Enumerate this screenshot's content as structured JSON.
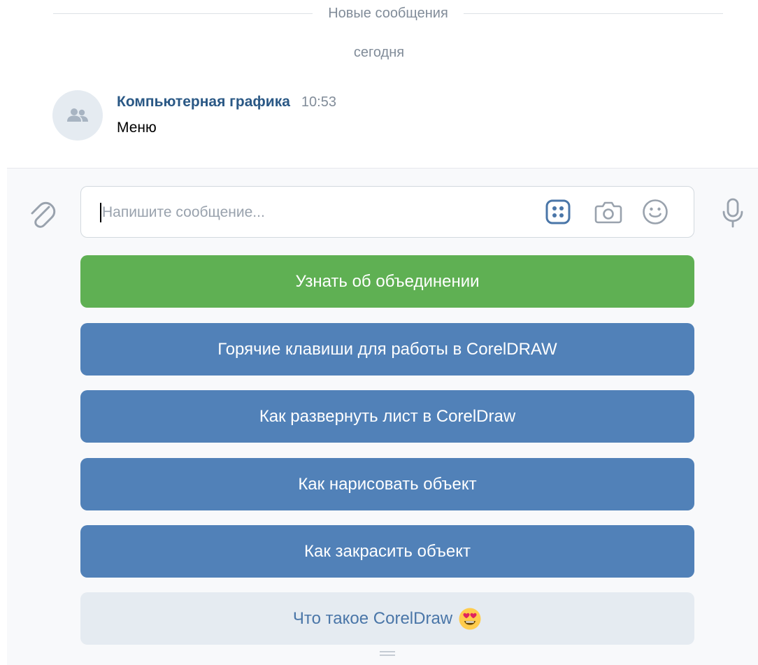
{
  "divider": {
    "label": "Новые сообщения"
  },
  "date_label": "сегодня",
  "message": {
    "avatar_icon": "users-icon",
    "author": "Компьютерная графика",
    "time": "10:53",
    "text": "Меню"
  },
  "composer": {
    "placeholder": "Напишите сообщение...",
    "value": "",
    "icons": {
      "attach": "paperclip-icon",
      "keyboard": "bot-keyboard-icon",
      "camera": "camera-icon",
      "emoji": "smile-icon",
      "mic": "microphone-icon"
    }
  },
  "keyboard": {
    "buttons": [
      {
        "label": "Узнать об объединении",
        "color": "#5fb053"
      },
      {
        "label": "Горячие клавиши для работы в CorelDRAW",
        "color": "#5181b8"
      },
      {
        "label": "Как развернуть лист в CorelDraw",
        "color": "#5181b8"
      },
      {
        "label": "Как нарисовать объект",
        "color": "#5181b8"
      },
      {
        "label": "Как закрасить объект",
        "color": "#5181b8"
      },
      {
        "label": "Что такое CorelDraw",
        "color": "#e5ebf1",
        "emoji": "heart-eyes-emoji"
      }
    ]
  },
  "colors": {
    "accent": "#4a76a8",
    "author": "#2a5885",
    "muted": "#818c99",
    "green": "#5fb053",
    "blue": "#5181b8"
  }
}
